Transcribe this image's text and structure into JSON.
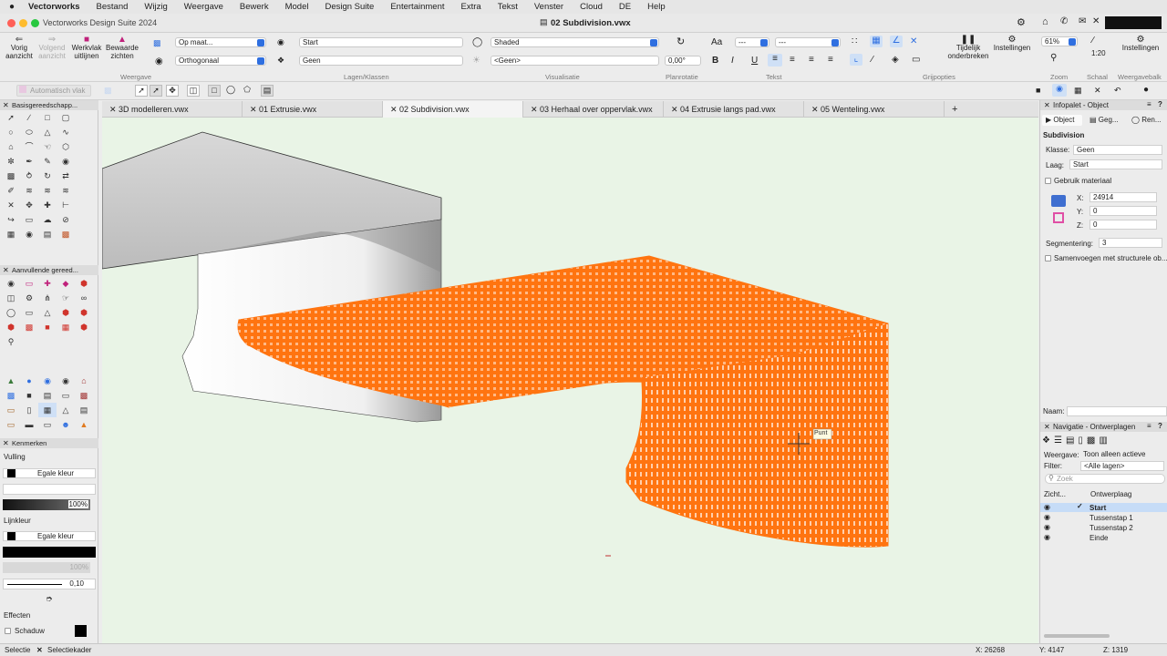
{
  "menubar": {
    "apple_icon": "apple-icon",
    "items": [
      "Vectorworks",
      "Bestand",
      "Wijzig",
      "Weergave",
      "Bewerk",
      "Model",
      "Design Suite",
      "Entertainment",
      "Extra",
      "Tekst",
      "Venster",
      "Cloud",
      "DE",
      "Help"
    ]
  },
  "window": {
    "app_title": "Vectorworks Design Suite 2024",
    "doc_title": "02 Subdivision.vwx"
  },
  "toolbar": {
    "vorig_label": "Vorig\naanzicht",
    "volgend_label": "Volgend\naanzicht",
    "werkvlak_label": "Werkvlak\nuitlijnen",
    "bewaarde_label": "Bewaarde\nzichten",
    "weergave_section": "Weergave",
    "view_select": "Op maat...",
    "projection_select": "Orthogonaal",
    "layer_select": "Start",
    "class_select": "Geen",
    "lagen_section": "Lagen/Klassen",
    "render_select": "Shaded",
    "light_select": "<Geen>",
    "visualisatie_section": "Visualisatie",
    "rotation_value": "0,00°",
    "planrotatie_section": "Planrotatie",
    "font_select1": "---",
    "font_select2": "---",
    "tekst_section": "Tekst",
    "grijpopties_section": "Grijpopties",
    "tijdelijk_label": "Tijdelijk\nonderbreken",
    "instellingen_label": "Instellingen",
    "zoom_value": "61%",
    "zoom_section": "Zoom",
    "scale_value": "1:20",
    "schaal_section": "Schaal",
    "instellingen2_label": "Instellingen",
    "weergavebalk_section": "Weergavebalk"
  },
  "subbar": {
    "workplane_label": "Automatisch vlak"
  },
  "tabs": [
    {
      "label": "3D modelleren.vwx"
    },
    {
      "label": "01 Extrusie.vwx"
    },
    {
      "label": "02 Subdivision.vwx"
    },
    {
      "label": "03 Herhaal over oppervlak.vwx"
    },
    {
      "label": "04 Extrusie langs pad.vwx"
    },
    {
      "label": "05 Wenteling.vwx"
    }
  ],
  "left_panels": {
    "basic_tools_title": "Basisgereedschapp...",
    "extra_tools_title": "Aanvullende gereed...",
    "attributes_title": "Kenmerken",
    "fill_label": "Vulling",
    "fill_value": "Egale kleur",
    "opacity_value": "100%",
    "line_label": "Lijnkleur",
    "line_value": "Egale kleur",
    "line_opacity": "100%",
    "line_thickness": "0,10",
    "effects_label": "Effecten",
    "shadow_label": "Schaduw"
  },
  "canvas": {
    "tooltip": "Punt"
  },
  "infopalette": {
    "title": "Infopalet - Object",
    "tab_object": "Object",
    "tab_data": "Geg...",
    "tab_render": "Ren...",
    "object_type": "Subdivision",
    "klasse_label": "Klasse:",
    "klasse_value": "Geen",
    "laag_label": "Laag:",
    "laag_value": "Start",
    "material_label": "Gebruik materiaal",
    "x_label": "X:",
    "x_value": "24914",
    "y_label": "Y:",
    "y_value": "0",
    "z_label": "Z:",
    "z_value": "0",
    "segment_label": "Segmentering:",
    "segment_value": "3",
    "merge_label": "Samenvoegen met structurele ob...",
    "naam_label": "Naam:"
  },
  "navigation": {
    "title": "Navigatie - Ontwerplagen",
    "weergave_label": "Weergave:",
    "weergave_value": "Toon alleen actieve",
    "filter_label": "Filter:",
    "filter_value": "<Alle lagen>",
    "search_placeholder": "Zoek",
    "col_visibility": "Zicht...",
    "col_layer": "Ontwerplaag",
    "layers": [
      {
        "name": "Start",
        "active": true
      },
      {
        "name": "Tussenstap 1",
        "active": false
      },
      {
        "name": "Tussenstap 2",
        "active": false
      },
      {
        "name": "Einde",
        "active": false
      }
    ]
  },
  "statusbar": {
    "mode": "Selectie",
    "close_icon": "close-icon",
    "tool_mode": "Selectiekader",
    "x_coord": "X: 26268",
    "y_coord": "Y: 4147",
    "z_coord": "Z: 1319"
  },
  "colors": {
    "mesh": "#ff6a00",
    "canvas_bg": "#e9f4e6",
    "accent": "#2f6fe0",
    "active_row": "#c6dcf7"
  }
}
